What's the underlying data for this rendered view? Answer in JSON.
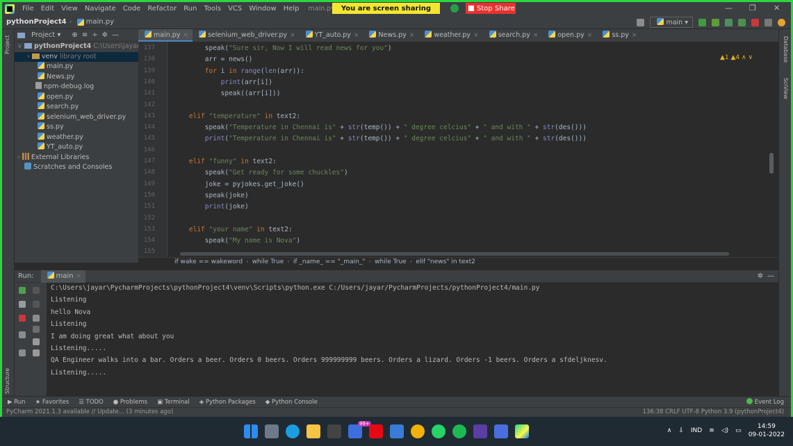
{
  "menubar": {
    "items": [
      "File",
      "Edit",
      "View",
      "Navigate",
      "Code",
      "Refactor",
      "Run",
      "Tools",
      "VCS",
      "Window",
      "Help"
    ],
    "title": "main.py [C:\\Users\\jayar\\",
    "sharing_text": "You are screen sharing",
    "stop_share": "Stop Share"
  },
  "navbar": {
    "project": "pythonProject4",
    "file": "main.py",
    "branch": "main ▾"
  },
  "project_panel": {
    "header": "Project ▾",
    "items": [
      {
        "label": "pythonProject4",
        "hint": "C:\\Users\\jayar\\Pych",
        "type": "root"
      },
      {
        "label": "venv",
        "hint": "library root",
        "type": "venv"
      },
      {
        "label": "main.py",
        "type": "py"
      },
      {
        "label": "News.py",
        "type": "py"
      },
      {
        "label": "npm-debug.log",
        "type": "log"
      },
      {
        "label": "open.py",
        "type": "py"
      },
      {
        "label": "search.py",
        "type": "py"
      },
      {
        "label": "selenium_web_driver.py",
        "type": "py"
      },
      {
        "label": "ss.py",
        "type": "py"
      },
      {
        "label": "weather.py",
        "type": "py"
      },
      {
        "label": "YT_auto.py",
        "type": "py"
      },
      {
        "label": "External Libraries",
        "type": "lib"
      },
      {
        "label": "Scratches and Consoles",
        "type": "scratch"
      }
    ]
  },
  "tabs": [
    "main.py",
    "selenium_web_driver.py",
    "YT_auto.py",
    "News.py",
    "weather.py",
    "search.py",
    "open.py",
    "ss.py"
  ],
  "editor": {
    "warnings": "▲1 ▲4 ∧ ∨",
    "lines": [
      {
        "n": "137",
        "code": "        speak(\"Sure sir, Now I will read news for you\")"
      },
      {
        "n": "138",
        "code": "        arr = news()"
      },
      {
        "n": "139",
        "code": "        for i in range(len(arr)):"
      },
      {
        "n": "140",
        "code": "            print(arr[i])"
      },
      {
        "n": "141",
        "code": "            speak((arr[i]))"
      },
      {
        "n": "142",
        "code": ""
      },
      {
        "n": "143",
        "code": "    elif \"temperature\" in text2:"
      },
      {
        "n": "144",
        "code": "        speak(\"Temperature in Chennai is\" + str(temp()) + \" degree celcius\" + \" and with \" + str(des()))"
      },
      {
        "n": "145",
        "code": "        print(\"Temperature in Chennai is\" + str(temp()) + \" degree celcius\" + \" and with \" + str(des()))"
      },
      {
        "n": "146",
        "code": ""
      },
      {
        "n": "147",
        "code": "    elif \"funny\" in text2:"
      },
      {
        "n": "148",
        "code": "        speak(\"Get ready for some chuckles\")"
      },
      {
        "n": "149",
        "code": "        joke = pyjokes.get_joke()"
      },
      {
        "n": "150",
        "code": "        speak(joke)"
      },
      {
        "n": "151",
        "code": "        print(joke)"
      },
      {
        "n": "152",
        "code": ""
      },
      {
        "n": "153",
        "code": "    elif \"your name\" in text2:"
      },
      {
        "n": "154",
        "code": "        speak(\"My name is Nova\")"
      },
      {
        "n": "155",
        "code": ""
      }
    ]
  },
  "breadcrumb": [
    "if wake == wakeword",
    "while True",
    "if _name_ == \"_main_\"",
    "while True",
    "elif \"news\" in text2"
  ],
  "run": {
    "label": "Run:",
    "config": "main",
    "output": [
      "C:\\Users\\jayar\\PycharmProjects\\pythonProject4\\venv\\Scripts\\python.exe C:/Users/jayar/PycharmProjects/pythonProject4/main.py",
      "Listening",
      "hello Nova",
      "Listening",
      "I am doing great what about you",
      "Listening.....",
      "QA Engineer walks into a bar. Orders a beer. Orders 0 beers. Orders 999999999 beers. Orders a lizard. Orders -1 beers. Orders a sfdeljknesv.",
      "Listening....."
    ]
  },
  "bottombar": {
    "items": [
      "Run",
      "Favorites",
      "TODO",
      "Problems",
      "Terminal",
      "Python Packages",
      "Python Console"
    ],
    "event_log": "Event Log"
  },
  "status": {
    "left": "PyCharm 2021.1.3 available // Update... (3 minutes ago)",
    "right": "136:38  CRLF  UTF-8  Python 3.9 (pythonProject4)"
  },
  "side_labels": {
    "left_top": "Project",
    "left_bottom": "Structure",
    "right_top": "Database",
    "right_bottom": "SciView"
  },
  "taskbar": {
    "badge": "99+",
    "lang": "IND",
    "time": "14:59",
    "date": "09-01-2022"
  }
}
